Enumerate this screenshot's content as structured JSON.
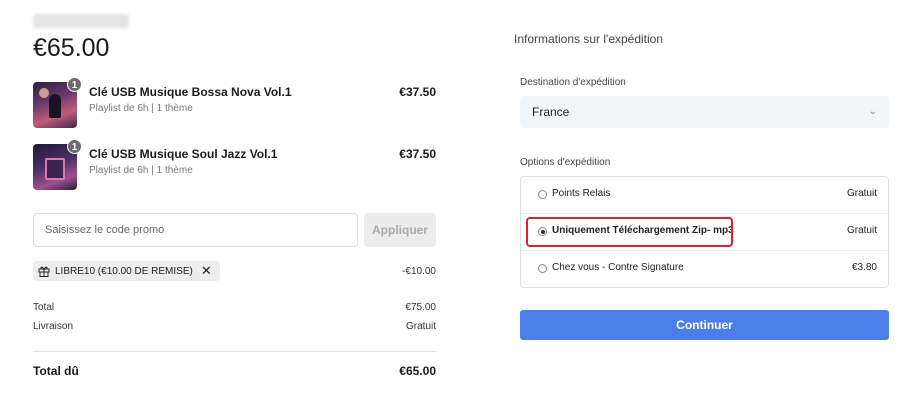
{
  "order": {
    "total_big": "€65.00",
    "items": [
      {
        "title": "Clé USB Musique Bossa Nova Vol.1",
        "subtitle": "Playlist de 6h | 1 thème",
        "price": "€37.50",
        "qty": "1"
      },
      {
        "title": "Clé USB Musique Soul Jazz Vol.1",
        "subtitle": "Playlist de 6h | 1 thème",
        "price": "€37.50",
        "qty": "1"
      }
    ],
    "promo": {
      "placeholder": "Saisissez le code promo",
      "button": "Appliquer"
    },
    "coupon": {
      "label": "LIBRE10 (€10.00 DE REMISE)",
      "remove": "✕",
      "amount": "-€10.00"
    },
    "summary": [
      {
        "label": "Total",
        "value": "€75.00"
      },
      {
        "label": "Livraison",
        "value": "Gratuit"
      }
    ],
    "due": {
      "label": "Total dû",
      "value": "€65.00"
    }
  },
  "shipping": {
    "title": "Informations sur l'expédition",
    "destination_label": "Destination d'expédition",
    "destination_value": "France",
    "options_label": "Options d'expédition",
    "options": [
      {
        "label": "Points Relais",
        "price": "Gratuit",
        "selected": false
      },
      {
        "label": "Uniquement Téléchargement Zip- mp3",
        "price": "Gratuit",
        "selected": true
      },
      {
        "label": "Chez vous - Contre Signature",
        "price": "€3.80",
        "selected": false
      }
    ],
    "continue_label": "Continuer"
  },
  "colors": {
    "accent": "#4b7fe8",
    "highlight": "#d9232f"
  },
  "icons": {
    "gift": "gift-icon",
    "remove": "close-icon",
    "dropdown": "chevron-down-icon",
    "radio": "radio-icon"
  }
}
